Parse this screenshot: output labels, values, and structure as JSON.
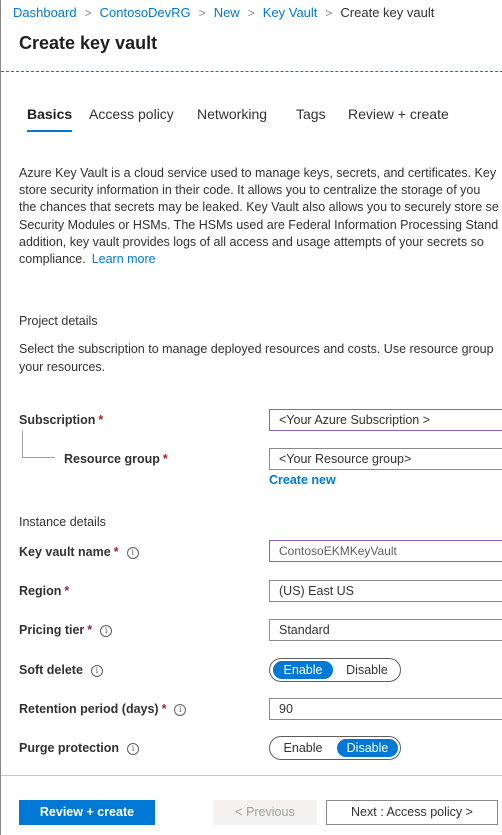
{
  "breadcrumb": {
    "items": [
      "Dashboard",
      "ContosoDevRG",
      "New",
      "Key Vault"
    ],
    "current": "Create key vault",
    "separator": ">"
  },
  "page_title": "Create key vault",
  "tabs": [
    "Basics",
    "Access policy",
    "Networking",
    "Tags",
    "Review + create"
  ],
  "active_tab": "Basics",
  "description": {
    "lines": [
      "Azure Key Vault is a cloud service used to manage keys, secrets, and certificates. Key",
      "store security information in their code. It allows you to centralize the storage of you",
      "the chances that secrets may be leaked. Key Vault also allows you to securely store se",
      "Security Modules or HSMs. The HSMs used are Federal Information Processing Stand",
      "addition, key vault provides logs of all access and usage attempts of your secrets so",
      "compliance."
    ],
    "learn_more": "Learn more"
  },
  "project_details": {
    "heading": "Project details",
    "sub_lines": [
      "Select the subscription to manage deployed resources and costs. Use resource group",
      "your resources."
    ],
    "subscription_label": "Subscription",
    "subscription_value": "<Your Azure Subscription >",
    "resource_group_label": "Resource group",
    "resource_group_value": "<Your Resource group>",
    "create_new": "Create new"
  },
  "instance_details": {
    "heading": "Instance details",
    "key_vault_name_label": "Key vault name",
    "key_vault_name_value": "ContosoEKMKeyVault",
    "region_label": "Region",
    "region_value": "(US) East US",
    "pricing_tier_label": "Pricing tier",
    "pricing_tier_value": "Standard",
    "soft_delete_label": "Soft delete",
    "soft_delete_options": [
      "Enable",
      "Disable"
    ],
    "soft_delete_selected": "Enable",
    "retention_label": "Retention period (days)",
    "retention_value": "90",
    "purge_label": "Purge protection",
    "purge_options": [
      "Enable",
      "Disable"
    ],
    "purge_selected": "Disable"
  },
  "required_marker": "*",
  "info_glyph": "i",
  "footer": {
    "review_create": "Review + create",
    "previous": "< Previous",
    "next": "Next : Access policy >"
  },
  "colors": {
    "accent": "#0078d4",
    "required": "#a4262c",
    "focus_border": "#8661c5"
  }
}
